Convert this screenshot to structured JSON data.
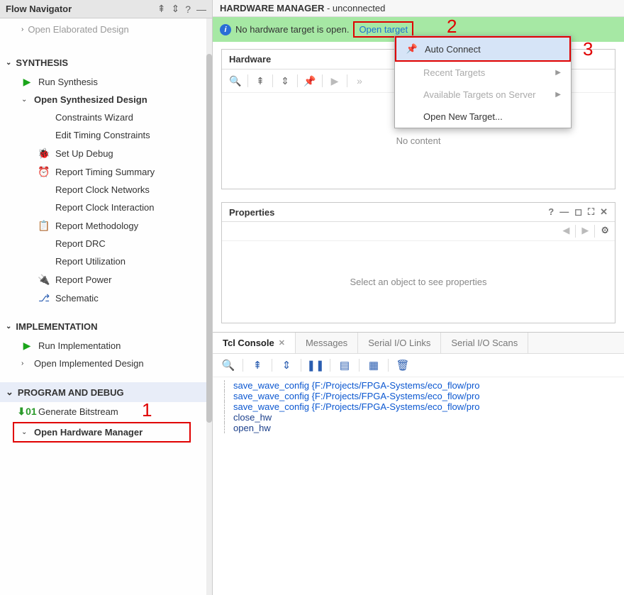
{
  "sidebar": {
    "title": "Flow Navigator",
    "truncated_item": "Open Elaborated Design",
    "sections": {
      "synthesis": {
        "title": "SYNTHESIS",
        "run": "Run Synthesis",
        "open": "Open Synthesized Design",
        "items": [
          "Constraints Wizard",
          "Edit Timing Constraints",
          "Set Up Debug",
          "Report Timing Summary",
          "Report Clock Networks",
          "Report Clock Interaction",
          "Report Methodology",
          "Report DRC",
          "Report Utilization",
          "Report Power",
          "Schematic"
        ]
      },
      "implementation": {
        "title": "IMPLEMENTATION",
        "run": "Run Implementation",
        "open": "Open Implemented Design"
      },
      "program": {
        "title": "PROGRAM AND DEBUG",
        "gen": "Generate Bitstream",
        "open_hw": "Open Hardware Manager"
      }
    }
  },
  "main": {
    "header_bold": "HARDWARE MANAGER",
    "header_suffix": " - unconnected",
    "info_text": "No hardware target is open.",
    "open_target": "Open target",
    "dropdown": {
      "auto": "Auto Connect",
      "recent": "Recent Targets",
      "avail": "Available Targets on Server",
      "new": "Open New Target..."
    },
    "hardware": {
      "title": "Hardware",
      "empty": "No content"
    },
    "props": {
      "title": "Properties",
      "empty": "Select an object to see properties"
    },
    "tabs": {
      "tcl": "Tcl Console",
      "msg": "Messages",
      "sio_links": "Serial I/O Links",
      "sio_scans": "Serial I/O Scans"
    },
    "console_lines": [
      "save_wave_config {F:/Projects/FPGA-Systems/eco_flow/pro",
      "save_wave_config {F:/Projects/FPGA-Systems/eco_flow/pro",
      "save_wave_config {F:/Projects/FPGA-Systems/eco_flow/pro",
      "close_hw",
      "open_hw"
    ]
  },
  "annotations": {
    "a1": "1",
    "a2": "2",
    "a3": "3"
  }
}
